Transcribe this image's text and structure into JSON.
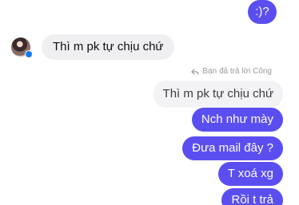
{
  "conversation": {
    "top_message": ":)?",
    "incoming_message": "Thì m pk tự chịu chứ",
    "reply_context": "Bạn đã trả lời Công",
    "quoted_message": "Thì m pk tự chịu chứ",
    "outgoing_messages": [
      "Nch như mày",
      "Đưa mail đây ?",
      "T  xoá xg",
      "Rồi t trả"
    ]
  },
  "colors": {
    "outgoing_bubble": "#5b4ef0",
    "incoming_bubble": "#efeff1",
    "meta_text": "#9a9aa2",
    "badge": "#1877f2"
  }
}
